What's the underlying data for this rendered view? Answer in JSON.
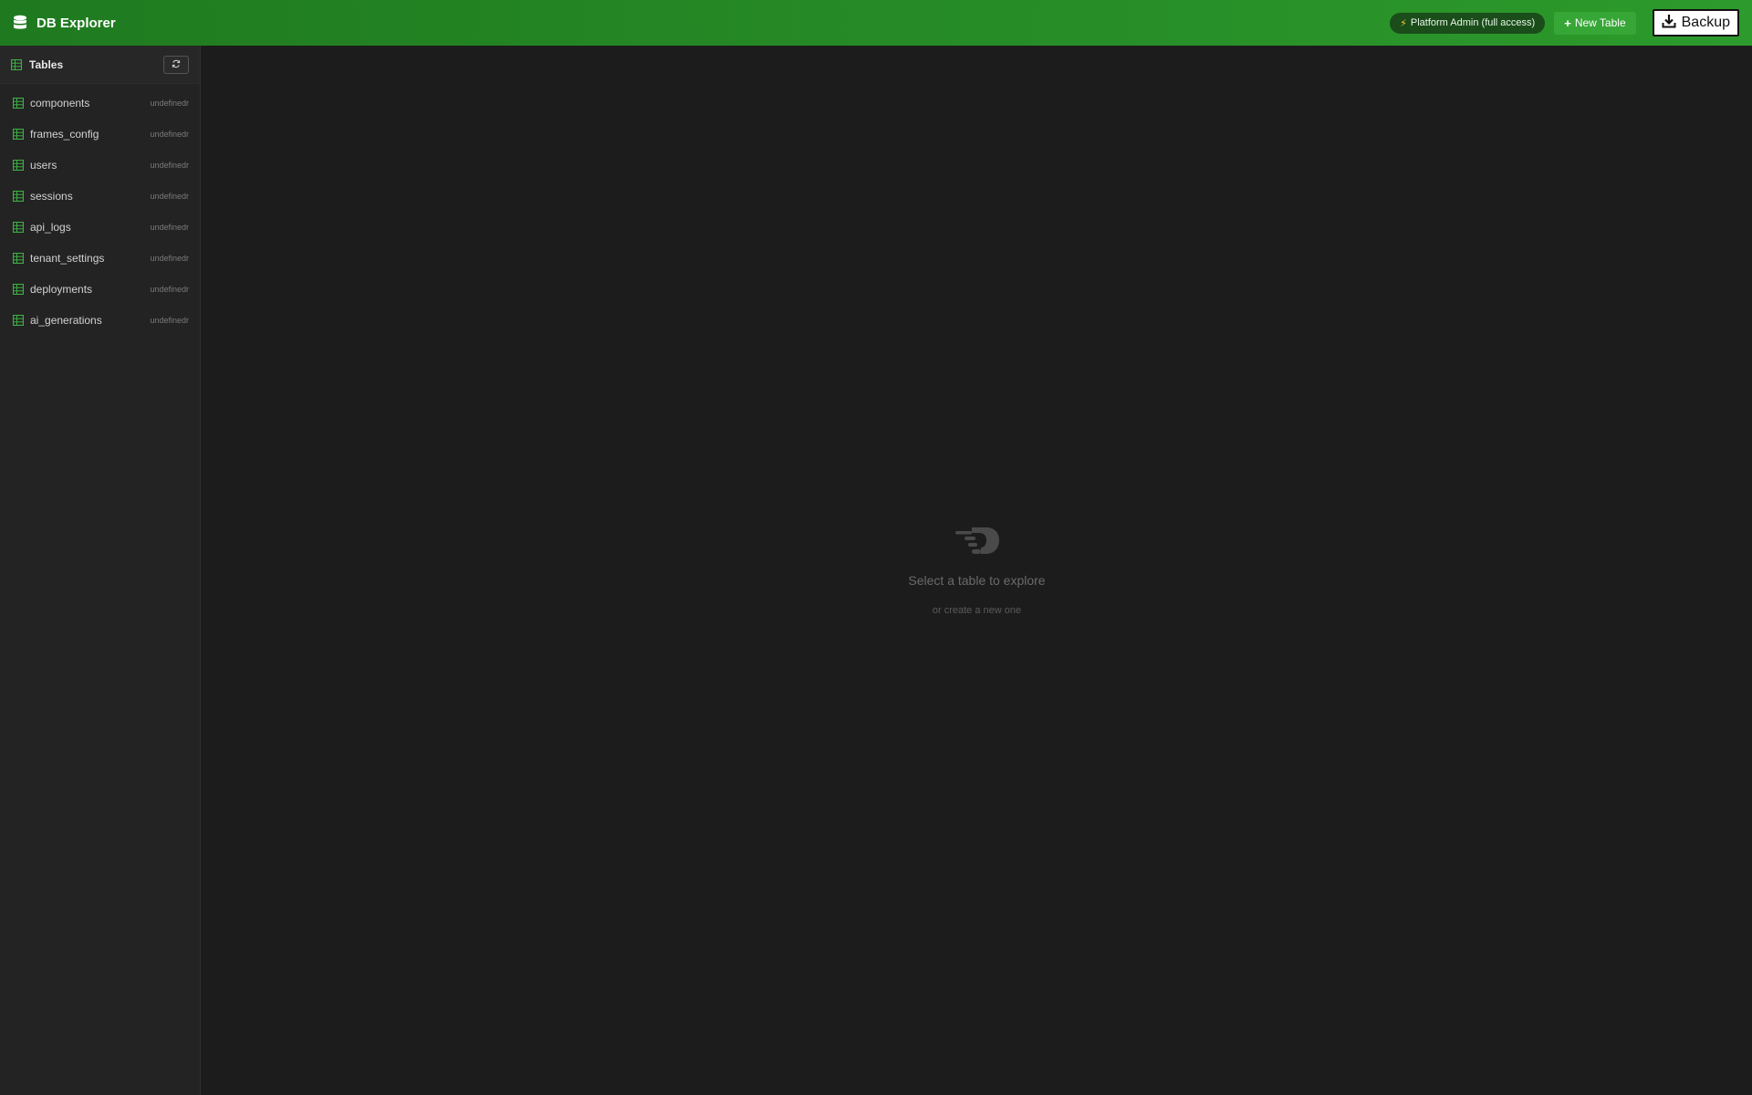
{
  "app": {
    "title": "DB Explorer"
  },
  "topbar": {
    "admin_badge": "Platform Admin (full access)",
    "new_table_label": "New Table",
    "backup_label": "Backup"
  },
  "sidebar": {
    "title": "Tables",
    "tables": [
      {
        "name": "components",
        "count": "undefinedr"
      },
      {
        "name": "frames_config",
        "count": "undefinedr"
      },
      {
        "name": "users",
        "count": "undefinedr"
      },
      {
        "name": "sessions",
        "count": "undefinedr"
      },
      {
        "name": "api_logs",
        "count": "undefinedr"
      },
      {
        "name": "tenant_settings",
        "count": "undefinedr"
      },
      {
        "name": "deployments",
        "count": "undefinedr"
      },
      {
        "name": "ai_generations",
        "count": "undefinedr"
      }
    ]
  },
  "main": {
    "empty_title": "Select a table to explore",
    "empty_subtitle": "or create a new one"
  },
  "colors": {
    "accent": "#2c9a2c",
    "table_icon": "#3cb043"
  }
}
